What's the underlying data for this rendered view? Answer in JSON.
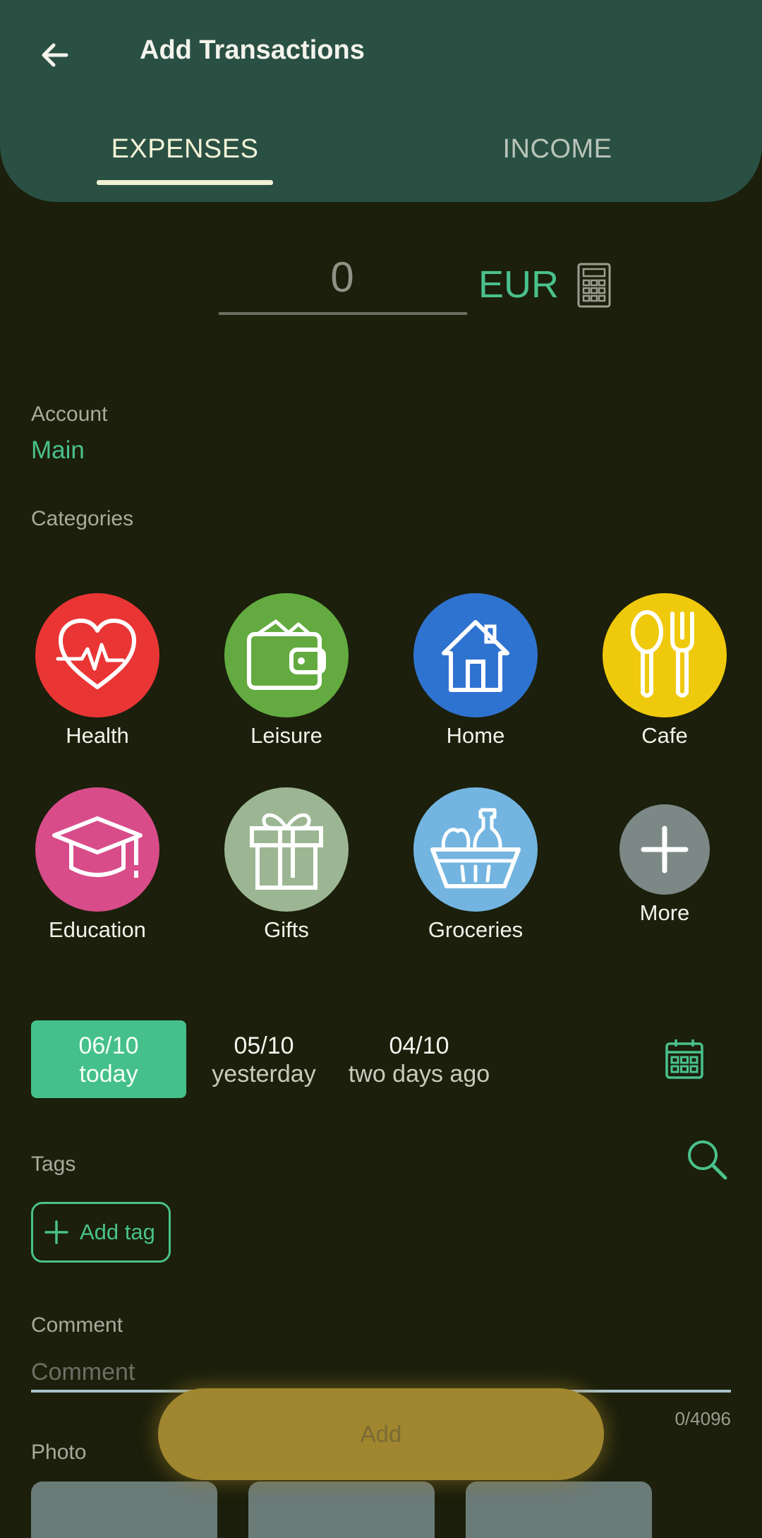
{
  "header": {
    "title": "Add Transactions",
    "tabs": [
      {
        "label": "EXPENSES",
        "selected": true
      },
      {
        "label": "INCOME",
        "selected": false
      }
    ]
  },
  "amount": {
    "value": "0",
    "currency": "EUR"
  },
  "account": {
    "label": "Account",
    "value": "Main"
  },
  "categories": {
    "label": "Categories",
    "items": [
      {
        "name": "Health",
        "color": "#ea3535",
        "icon": "heart-pulse-icon"
      },
      {
        "name": "Leisure",
        "color": "#63ab40",
        "icon": "wallet-icon"
      },
      {
        "name": "Home",
        "color": "#2f73d0",
        "icon": "house-icon"
      },
      {
        "name": "Cafe",
        "color": "#efc90c",
        "icon": "spoon-fork-icon"
      },
      {
        "name": "Education",
        "color": "#d84c8a",
        "icon": "graduation-cap-icon"
      },
      {
        "name": "Gifts",
        "color": "#9cb693",
        "icon": "gift-icon"
      },
      {
        "name": "Groceries",
        "color": "#73b5e0",
        "icon": "grocery-basket-icon"
      },
      {
        "name": "More",
        "color": "#7b8886",
        "icon": "plus-icon"
      }
    ]
  },
  "dates": [
    {
      "date": "06/10",
      "label": "today",
      "selected": true
    },
    {
      "date": "05/10",
      "label": "yesterday",
      "selected": false
    },
    {
      "date": "04/10",
      "label": "two days ago",
      "selected": false
    }
  ],
  "tags": {
    "label": "Tags",
    "add_label": "Add tag"
  },
  "comment": {
    "label": "Comment",
    "placeholder": "Comment",
    "counter": "0/4096"
  },
  "photo": {
    "label": "Photo"
  },
  "add_button": {
    "label": "Add"
  },
  "colors": {
    "accent": "#4ac18d",
    "header_bg": "#2a5044",
    "background": "#1b1f0b",
    "add_button": "#a0862e"
  }
}
